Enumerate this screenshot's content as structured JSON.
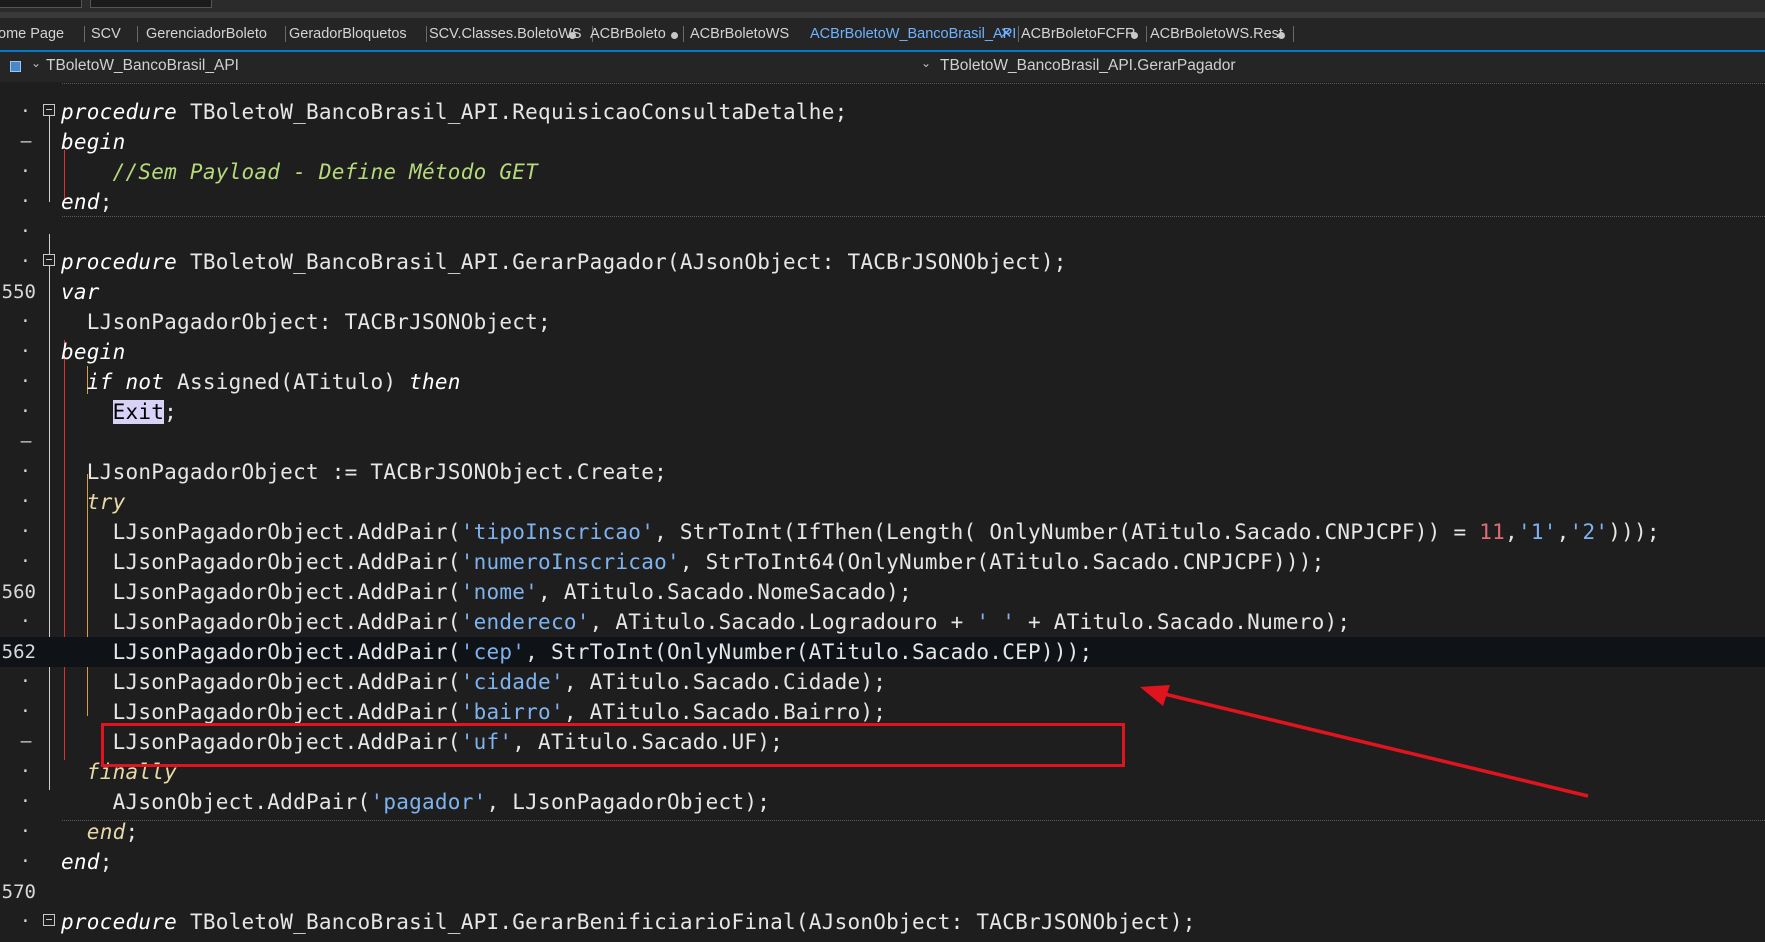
{
  "tabs": [
    {
      "label": "ome Page",
      "active": false,
      "modified": false
    },
    {
      "label": "SCV",
      "active": false,
      "modified": false
    },
    {
      "label": "GerenciadorBoleto",
      "active": false,
      "modified": false
    },
    {
      "label": "GeradorBloquetos",
      "active": false,
      "modified": false
    },
    {
      "label": "SCV.Classes.BoletoWS",
      "active": false,
      "modified": true
    },
    {
      "label": "ACBrBoleto",
      "active": false,
      "modified": true
    },
    {
      "label": "ACBrBoletoWS",
      "active": false,
      "modified": false
    },
    {
      "label": "ACBrBoletoW_BancoBrasil_API",
      "active": true,
      "modified": false
    },
    {
      "label": "ACBrBoletoFCFR",
      "active": false,
      "modified": true
    },
    {
      "label": "ACBrBoletoWS.Rest",
      "active": false,
      "modified": true
    }
  ],
  "tab_close_glyph": "✕",
  "navbar": {
    "class_name": "TBoletoW_BancoBrasil_API",
    "method_name": "TBoletoW_BancoBrasil_API.GerarPagador",
    "chevron": "⌄"
  },
  "gutter": {
    "dot": "·",
    "dash": "–"
  },
  "code_lines": [
    {
      "gutter": "",
      "tokens": []
    },
    {
      "gutter": "·",
      "tokens": [
        {
          "t": "procedure",
          "c": "kw"
        },
        {
          "t": " TBoletoW_BancoBrasil_API.RequisicaoConsultaDetalhe;"
        }
      ]
    },
    {
      "gutter": "–",
      "tokens": [
        {
          "t": "begin",
          "c": "kw"
        }
      ]
    },
    {
      "gutter": "·",
      "tokens": [
        {
          "t": "    "
        },
        {
          "t": "//Sem Payload - Define Método GET",
          "c": "cmt"
        }
      ]
    },
    {
      "gutter": "·",
      "tokens": [
        {
          "t": "end",
          "c": "kw"
        },
        {
          "t": ";"
        }
      ]
    },
    {
      "gutter": "·",
      "tokens": []
    },
    {
      "gutter": "·",
      "tokens": [
        {
          "t": "procedure",
          "c": "kw"
        },
        {
          "t": " TBoletoW_BancoBrasil_API.GerarPagador(AJsonObject: TACBrJSONObject);"
        }
      ]
    },
    {
      "gutter": "550",
      "tokens": [
        {
          "t": "var",
          "c": "kw"
        }
      ]
    },
    {
      "gutter": "·",
      "tokens": [
        {
          "t": "  LJsonPagadorObject: TACBrJSONObject;"
        }
      ]
    },
    {
      "gutter": "·",
      "tokens": [
        {
          "t": "begin",
          "c": "kw"
        }
      ]
    },
    {
      "gutter": "·",
      "tokens": [
        {
          "t": "  "
        },
        {
          "t": "if not",
          "c": "kw"
        },
        {
          "t": " Assigned(ATitulo) "
        },
        {
          "t": "then",
          "c": "kw"
        }
      ]
    },
    {
      "gutter": "·",
      "tokens": [
        {
          "t": "    "
        },
        {
          "t": "Exit",
          "c": "hl"
        },
        {
          "t": ";"
        }
      ]
    },
    {
      "gutter": "–",
      "tokens": []
    },
    {
      "gutter": "·",
      "tokens": [
        {
          "t": "  LJsonPagadorObject := TACBrJSONObject.Create;"
        }
      ]
    },
    {
      "gutter": "·",
      "tokens": [
        {
          "t": "  "
        },
        {
          "t": "try",
          "c": "kw2"
        }
      ]
    },
    {
      "gutter": "·",
      "tokens": [
        {
          "t": "    LJsonPagadorObject.AddPair("
        },
        {
          "t": "'tipoInscricao'",
          "c": "str"
        },
        {
          "t": ", StrToInt(IfThen(Length( OnlyNumber(ATitulo.Sacado.CNPJCPF)) = "
        },
        {
          "t": "11",
          "c": "num"
        },
        {
          "t": ","
        },
        {
          "t": "'1'",
          "c": "str"
        },
        {
          "t": ","
        },
        {
          "t": "'2'",
          "c": "str"
        },
        {
          "t": ")));"
        }
      ]
    },
    {
      "gutter": "·",
      "tokens": [
        {
          "t": "    LJsonPagadorObject.AddPair("
        },
        {
          "t": "'numeroInscricao'",
          "c": "str"
        },
        {
          "t": ", StrToInt64(OnlyNumber(ATitulo.Sacado.CNPJCPF)));"
        }
      ]
    },
    {
      "gutter": "560",
      "tokens": [
        {
          "t": "    LJsonPagadorObject.AddPair("
        },
        {
          "t": "'nome'",
          "c": "str"
        },
        {
          "t": ", ATitulo.Sacado.NomeSacado);"
        }
      ]
    },
    {
      "gutter": "·",
      "tokens": [
        {
          "t": "    LJsonPagadorObject.AddPair("
        },
        {
          "t": "'endereco'",
          "c": "str"
        },
        {
          "t": ", ATitulo.Sacado.Logradouro + "
        },
        {
          "t": "' '",
          "c": "str"
        },
        {
          "t": " + ATitulo.Sacado.Numero);"
        }
      ]
    },
    {
      "gutter": "562",
      "tokens": [
        {
          "t": "    LJsonPagadorObject.AddPair("
        },
        {
          "t": "'cep'",
          "c": "str"
        },
        {
          "t": ", StrToInt(OnlyNumber(ATitulo.Sacado.CEP)));"
        }
      ],
      "current": true
    },
    {
      "gutter": "·",
      "tokens": [
        {
          "t": "    LJsonPagadorObject.AddPair("
        },
        {
          "t": "'cidade'",
          "c": "str"
        },
        {
          "t": ", ATitulo.Sacado.Cidade);"
        }
      ]
    },
    {
      "gutter": "·",
      "tokens": [
        {
          "t": "    LJsonPagadorObject.AddPair("
        },
        {
          "t": "'bairro'",
          "c": "str"
        },
        {
          "t": ", ATitulo.Sacado.Bairro);"
        }
      ]
    },
    {
      "gutter": "–",
      "tokens": [
        {
          "t": "    LJsonPagadorObject.AddPair("
        },
        {
          "t": "'uf'",
          "c": "str"
        },
        {
          "t": ", ATitulo.Sacado.UF);"
        }
      ]
    },
    {
      "gutter": "·",
      "tokens": [
        {
          "t": "  "
        },
        {
          "t": "finally",
          "c": "kw2"
        }
      ]
    },
    {
      "gutter": "·",
      "tokens": [
        {
          "t": "    AJsonObject.AddPair("
        },
        {
          "t": "'pagador'",
          "c": "str"
        },
        {
          "t": ", LJsonPagadorObject);"
        }
      ]
    },
    {
      "gutter": "·",
      "tokens": [
        {
          "t": "  "
        },
        {
          "t": "end",
          "c": "kw2"
        },
        {
          "t": ";"
        }
      ]
    },
    {
      "gutter": "·",
      "tokens": [
        {
          "t": "end",
          "c": "kw"
        },
        {
          "t": ";"
        }
      ]
    },
    {
      "gutter": "570",
      "tokens": []
    },
    {
      "gutter": "·",
      "tokens": [
        {
          "t": "procedure",
          "c": "kw"
        },
        {
          "t": " TBoletoW_BancoBrasil_API.GerarBenificiarioFinal(AJsonObject: TACBrJSONObject);"
        }
      ]
    }
  ],
  "colors": {
    "background": "#1e1e1e",
    "accent": "#007acc",
    "string": "#7fb3f0",
    "number": "#e06c75",
    "comment": "#b6d97c",
    "highlight_box": "#e0141e"
  },
  "annotation": {
    "type": "red-rectangle-with-arrow",
    "target_line": "562"
  }
}
